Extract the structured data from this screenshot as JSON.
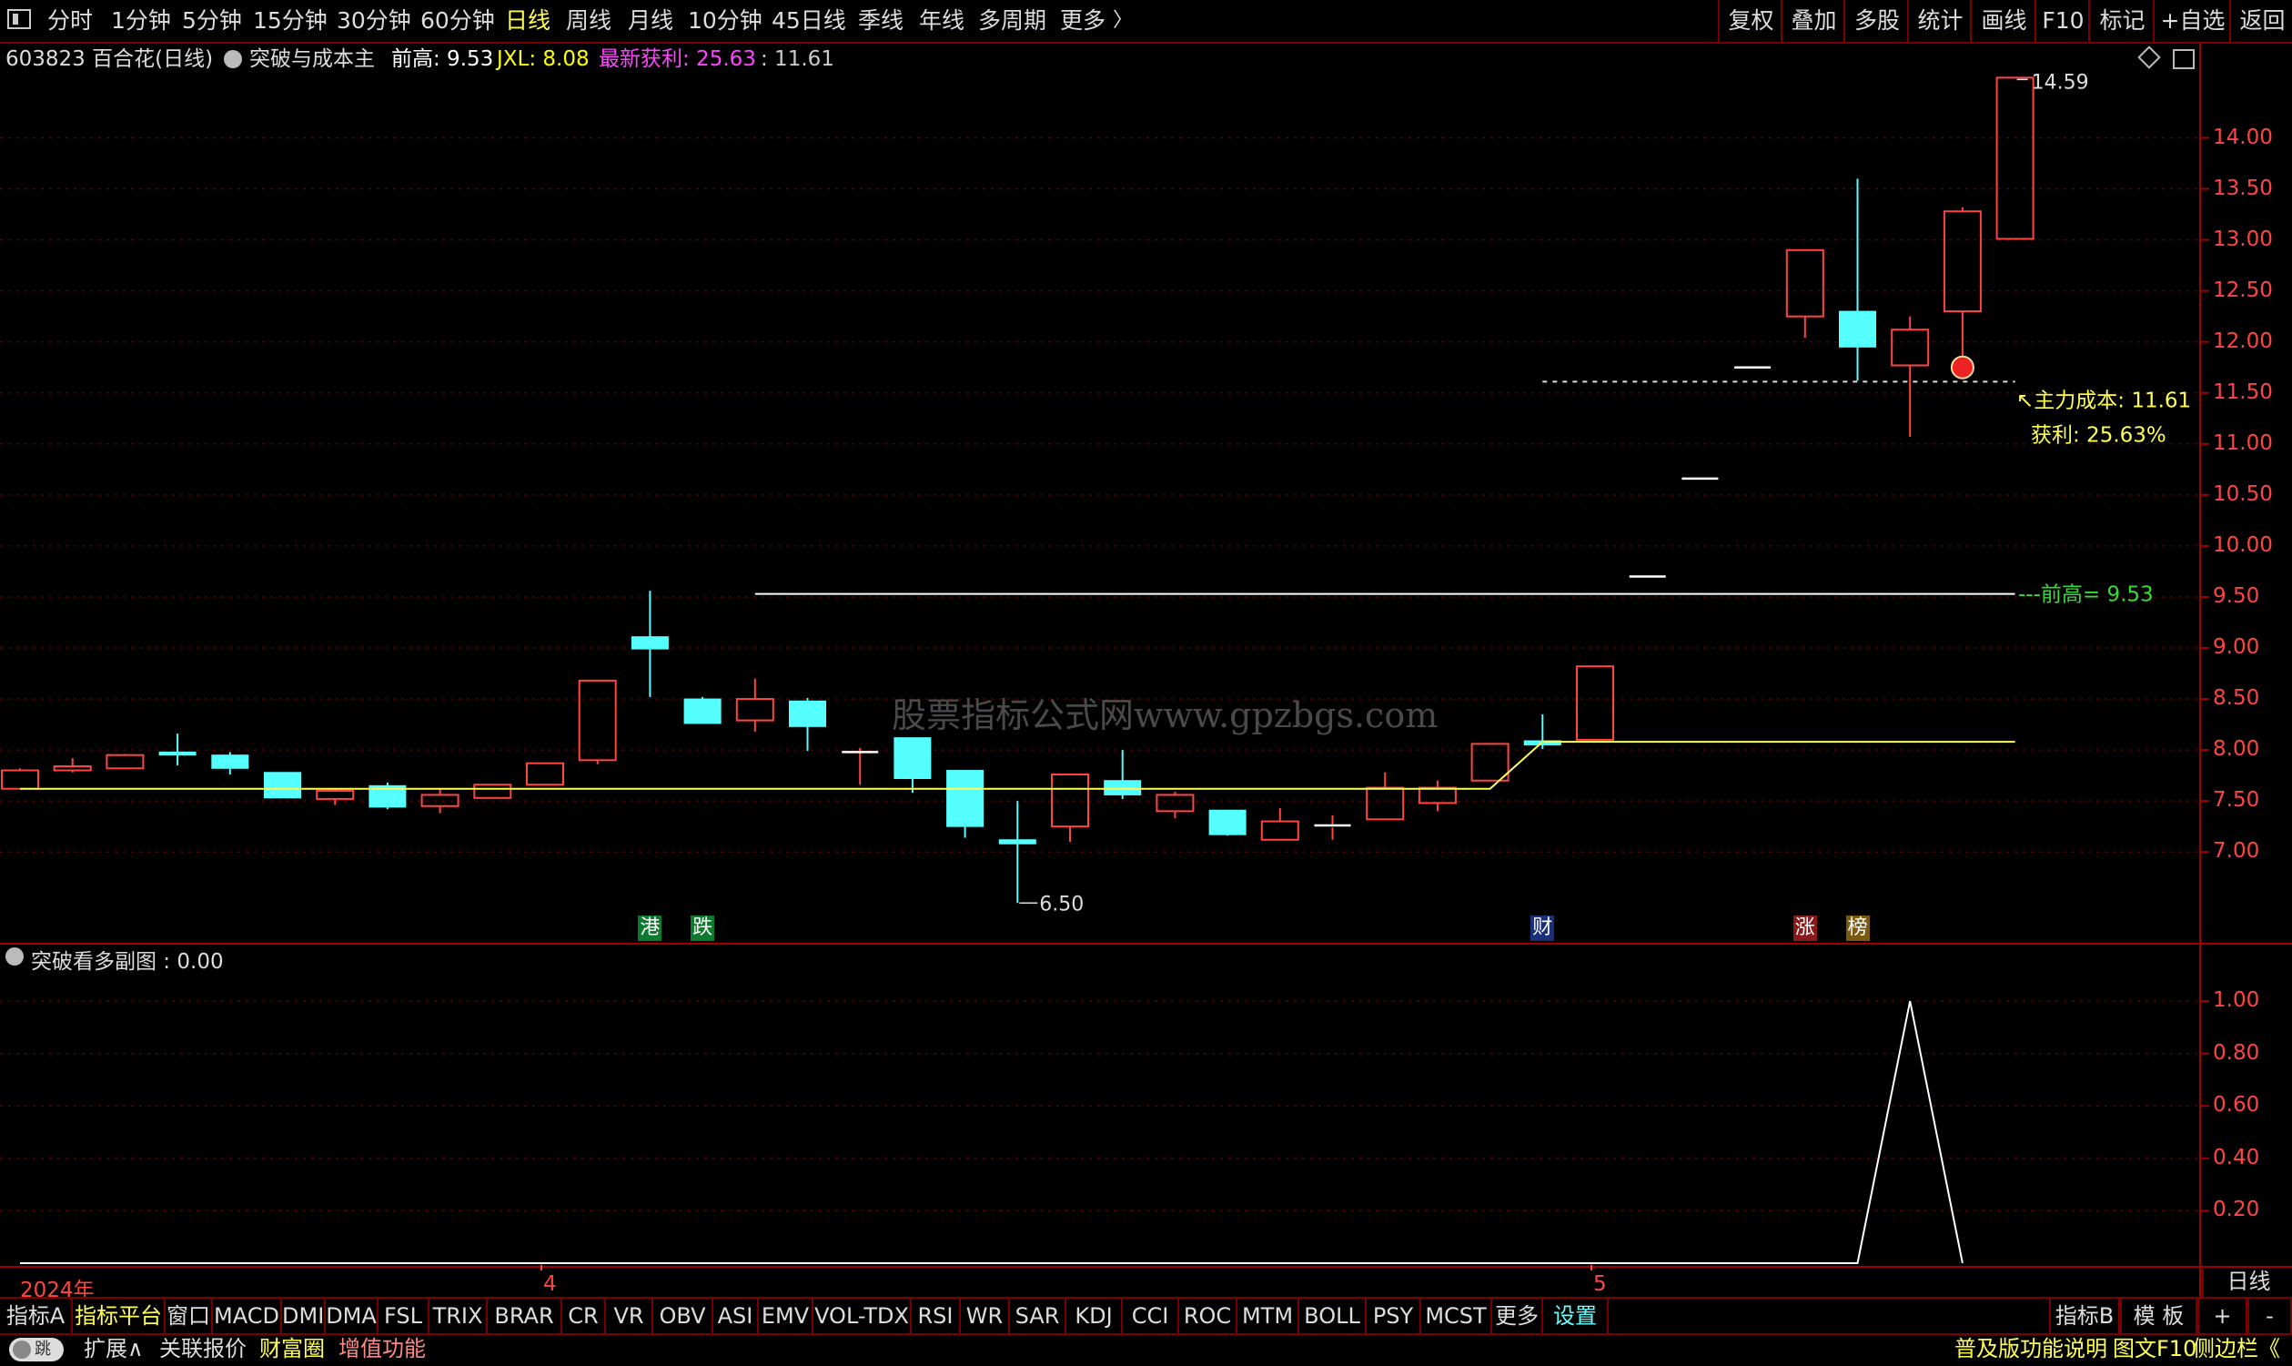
{
  "toolbar": {
    "periods": [
      "分时",
      "1分钟",
      "5分钟",
      "15分钟",
      "30分钟",
      "60分钟",
      "日线",
      "周线",
      "月线",
      "10分钟",
      "45日线",
      "季线",
      "年线",
      "多周期",
      "更多"
    ],
    "active_period": "日线",
    "right_buttons": [
      "复权",
      "叠加",
      "多股",
      "统计",
      "画线",
      "F10",
      "标记",
      "+自选",
      "返回"
    ]
  },
  "header": {
    "stock": "603823 百合花(日线)",
    "indicator": "突破与成本主",
    "prev_high_label": "前高: 9.53",
    "jxl_label": "JXL: 8.08",
    "profit_label": "最新获利: 25.63",
    "cost_value": ": 11.61",
    "colors": {
      "prev_high": "#ffffff",
      "jxl": "#ffff00",
      "profit": "#ff44ff",
      "cost": "#cccccc"
    }
  },
  "watermark": "股票指标公式网www.gpzbgs.com",
  "chart_data": [
    {
      "type": "candlestick",
      "title": "",
      "ylim": [
        6.4,
        14.8
      ],
      "yticks": [
        "7.00",
        "7.50",
        "8.00",
        "8.50",
        "9.00",
        "9.50",
        "10.00",
        "10.50",
        "11.00",
        "11.50",
        "12.00",
        "12.50",
        "13.00",
        "13.50",
        "14.00"
      ],
      "up_color": "#ff4444",
      "down_color": "#55ffff",
      "candles": [
        {
          "o": 7.62,
          "h": 7.82,
          "l": 7.62,
          "c": 7.8
        },
        {
          "o": 7.8,
          "h": 7.92,
          "l": 7.78,
          "c": 7.84
        },
        {
          "o": 7.82,
          "h": 7.96,
          "l": 7.82,
          "c": 7.95
        },
        {
          "o": 7.98,
          "h": 8.16,
          "l": 7.85,
          "c": 7.95
        },
        {
          "o": 7.95,
          "h": 7.98,
          "l": 7.76,
          "c": 7.82
        },
        {
          "o": 7.78,
          "h": 7.78,
          "l": 7.53,
          "c": 7.53
        },
        {
          "o": 7.52,
          "h": 7.62,
          "l": 7.46,
          "c": 7.6
        },
        {
          "o": 7.65,
          "h": 7.68,
          "l": 7.42,
          "c": 7.44
        },
        {
          "o": 7.45,
          "h": 7.62,
          "l": 7.38,
          "c": 7.56
        },
        {
          "o": 7.53,
          "h": 7.66,
          "l": 7.53,
          "c": 7.66
        },
        {
          "o": 7.66,
          "h": 7.87,
          "l": 7.66,
          "c": 7.87
        },
        {
          "o": 7.9,
          "h": 8.68,
          "l": 7.86,
          "c": 8.68
        },
        {
          "o": 9.11,
          "h": 9.56,
          "l": 8.52,
          "c": 8.99
        },
        {
          "o": 8.5,
          "h": 8.52,
          "l": 8.36,
          "c": 8.26
        },
        {
          "o": 8.29,
          "h": 8.7,
          "l": 8.18,
          "c": 8.5
        },
        {
          "o": 8.48,
          "h": 8.51,
          "l": 7.99,
          "c": 8.23
        },
        {
          "o": 7.98,
          "h": 8.02,
          "l": 7.66,
          "c": 7.98
        },
        {
          "o": 8.12,
          "h": 8.12,
          "l": 7.58,
          "c": 7.72
        },
        {
          "o": 7.8,
          "h": 7.8,
          "l": 7.14,
          "c": 7.25
        },
        {
          "o": 7.12,
          "h": 7.5,
          "l": 6.5,
          "c": 7.08
        },
        {
          "o": 7.25,
          "h": 7.76,
          "l": 7.1,
          "c": 7.76
        },
        {
          "o": 7.7,
          "h": 8.0,
          "l": 7.52,
          "c": 7.56
        },
        {
          "o": 7.4,
          "h": 7.59,
          "l": 7.33,
          "c": 7.56
        },
        {
          "o": 7.41,
          "h": 7.41,
          "l": 7.16,
          "c": 7.17
        },
        {
          "o": 7.12,
          "h": 7.43,
          "l": 7.12,
          "c": 7.3
        },
        {
          "o": 7.24,
          "h": 7.36,
          "l": 7.12,
          "c": 7.26
        },
        {
          "o": 7.32,
          "h": 7.78,
          "l": 7.32,
          "c": 7.63
        },
        {
          "o": 7.48,
          "h": 7.7,
          "l": 7.4,
          "c": 7.63
        },
        {
          "o": 7.7,
          "h": 8.06,
          "l": 7.7,
          "c": 8.06
        },
        {
          "o": 8.09,
          "h": 8.35,
          "l": 8.01,
          "c": 8.05
        },
        {
          "o": 8.1,
          "h": 8.82,
          "l": 8.1,
          "c": 8.82
        },
        {
          "o": 9.7,
          "h": 9.7,
          "l": 9.7,
          "c": 9.7
        },
        {
          "o": 10.66,
          "h": 10.66,
          "l": 10.66,
          "c": 10.66
        },
        {
          "o": 11.75,
          "h": 11.75,
          "l": 11.75,
          "c": 11.75
        },
        {
          "o": 12.25,
          "h": 12.9,
          "l": 12.04,
          "c": 12.9
        },
        {
          "o": 12.3,
          "h": 13.6,
          "l": 11.62,
          "c": 11.95
        },
        {
          "o": 11.77,
          "h": 12.25,
          "l": 11.07,
          "c": 12.12
        },
        {
          "o": 12.3,
          "h": 13.32,
          "l": 11.85,
          "c": 13.28
        },
        {
          "o": 13.01,
          "h": 14.59,
          "l": 13.01,
          "c": 14.59
        }
      ],
      "lines": [
        {
          "name": "JXL",
          "color": "#ffff55",
          "points": [
            [
              0,
              7.62
            ],
            [
              28,
              7.62
            ],
            [
              29,
              8.08
            ],
            [
              38,
              8.08
            ]
          ]
        },
        {
          "name": "前高",
          "color": "#ffffff",
          "points": [
            [
              14,
              9.53
            ],
            [
              38,
              9.53
            ]
          ]
        },
        {
          "name": "主力成本",
          "color": "#dddddd",
          "dashed": true,
          "points": [
            [
              29,
              11.61
            ],
            [
              38,
              11.61
            ]
          ]
        }
      ],
      "annotations": {
        "high_label": "14.59",
        "low_label": "6.50",
        "cost_label": "↖主力成本: 11.61",
        "profit_label": "获利: 25.63%",
        "prev_high_label": "---前高= 9.53"
      },
      "events": [
        {
          "index": 12,
          "text": "港",
          "bg": "#0d7a2e"
        },
        {
          "index": 13,
          "text": "跌",
          "bg": "#0d7a2e"
        },
        {
          "index": 29,
          "text": "财",
          "bg": "#1a2f7a"
        },
        {
          "index": 34,
          "text": "涨",
          "bg": "#8a1a1a"
        },
        {
          "index": 35,
          "text": "榜",
          "bg": "#7a5a10"
        }
      ],
      "dates": [
        {
          "index": 0,
          "label": "2024年"
        },
        {
          "index": 10,
          "label": "4"
        },
        {
          "index": 30,
          "label": "5"
        }
      ]
    },
    {
      "type": "line",
      "title": "突破看多副图 : 0.00",
      "ylim": [
        0.0,
        1.08
      ],
      "yticks": [
        "0.20",
        "0.40",
        "0.60",
        "0.80",
        "1.00"
      ],
      "values": [
        0,
        0,
        0,
        0,
        0,
        0,
        0,
        0,
        0,
        0,
        0,
        0,
        0,
        0,
        0,
        0,
        0,
        0,
        0,
        0,
        0,
        0,
        0,
        0,
        0,
        0,
        0,
        0,
        0,
        0,
        0,
        0,
        0,
        0,
        0,
        0,
        1,
        0
      ]
    }
  ],
  "tabs": [
    "指标A",
    "指标平台",
    "窗口",
    "MACD",
    "DMI",
    "DMA",
    "FSL",
    "TRIX",
    "BRAR",
    "CR",
    "VR",
    "OBV",
    "ASI",
    "EMV",
    "VOL-TDX",
    "RSI",
    "WR",
    "SAR",
    "KDJ",
    "CCI",
    "ROC",
    "MTM",
    "BOLL",
    "PSY",
    "MCST",
    "更多",
    "设置"
  ],
  "tabs_right": [
    "指标B",
    "模 板",
    "+",
    "-"
  ],
  "period_box": "日线",
  "bottom": {
    "toggle": "跳",
    "expand": "扩展∧",
    "links": [
      "关联报价",
      "财富圈",
      "增值功能"
    ],
    "right": [
      "普及版功能说明",
      "图文F10",
      "侧边栏《"
    ]
  }
}
